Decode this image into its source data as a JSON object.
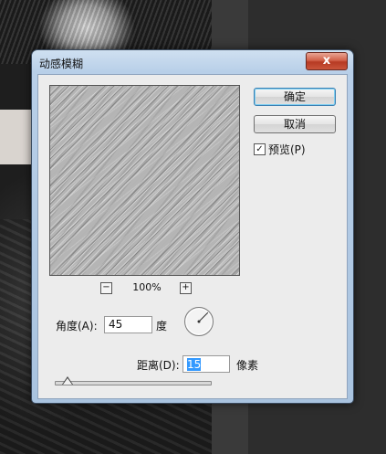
{
  "dialog": {
    "title": "动感模糊",
    "close_label": "x"
  },
  "preview": {
    "zoom_out_label": "−",
    "zoom_in_label": "+",
    "zoom_level": "100%"
  },
  "buttons": {
    "ok_label": "确定",
    "cancel_label": "取消"
  },
  "preview_checkbox": {
    "label": "预览(P)",
    "checked": true,
    "check_mark": "✓"
  },
  "angle": {
    "label": "角度(A):",
    "value": "45",
    "unit": "度"
  },
  "distance": {
    "label": "距离(D):",
    "value": "15",
    "unit": "像素",
    "slider_fraction": 0.02
  },
  "colors": {
    "title_gradient_top": "#cfe0f1",
    "client_bg": "#ececec",
    "close_red": "#c9553b",
    "selection_blue": "#3399ff"
  }
}
